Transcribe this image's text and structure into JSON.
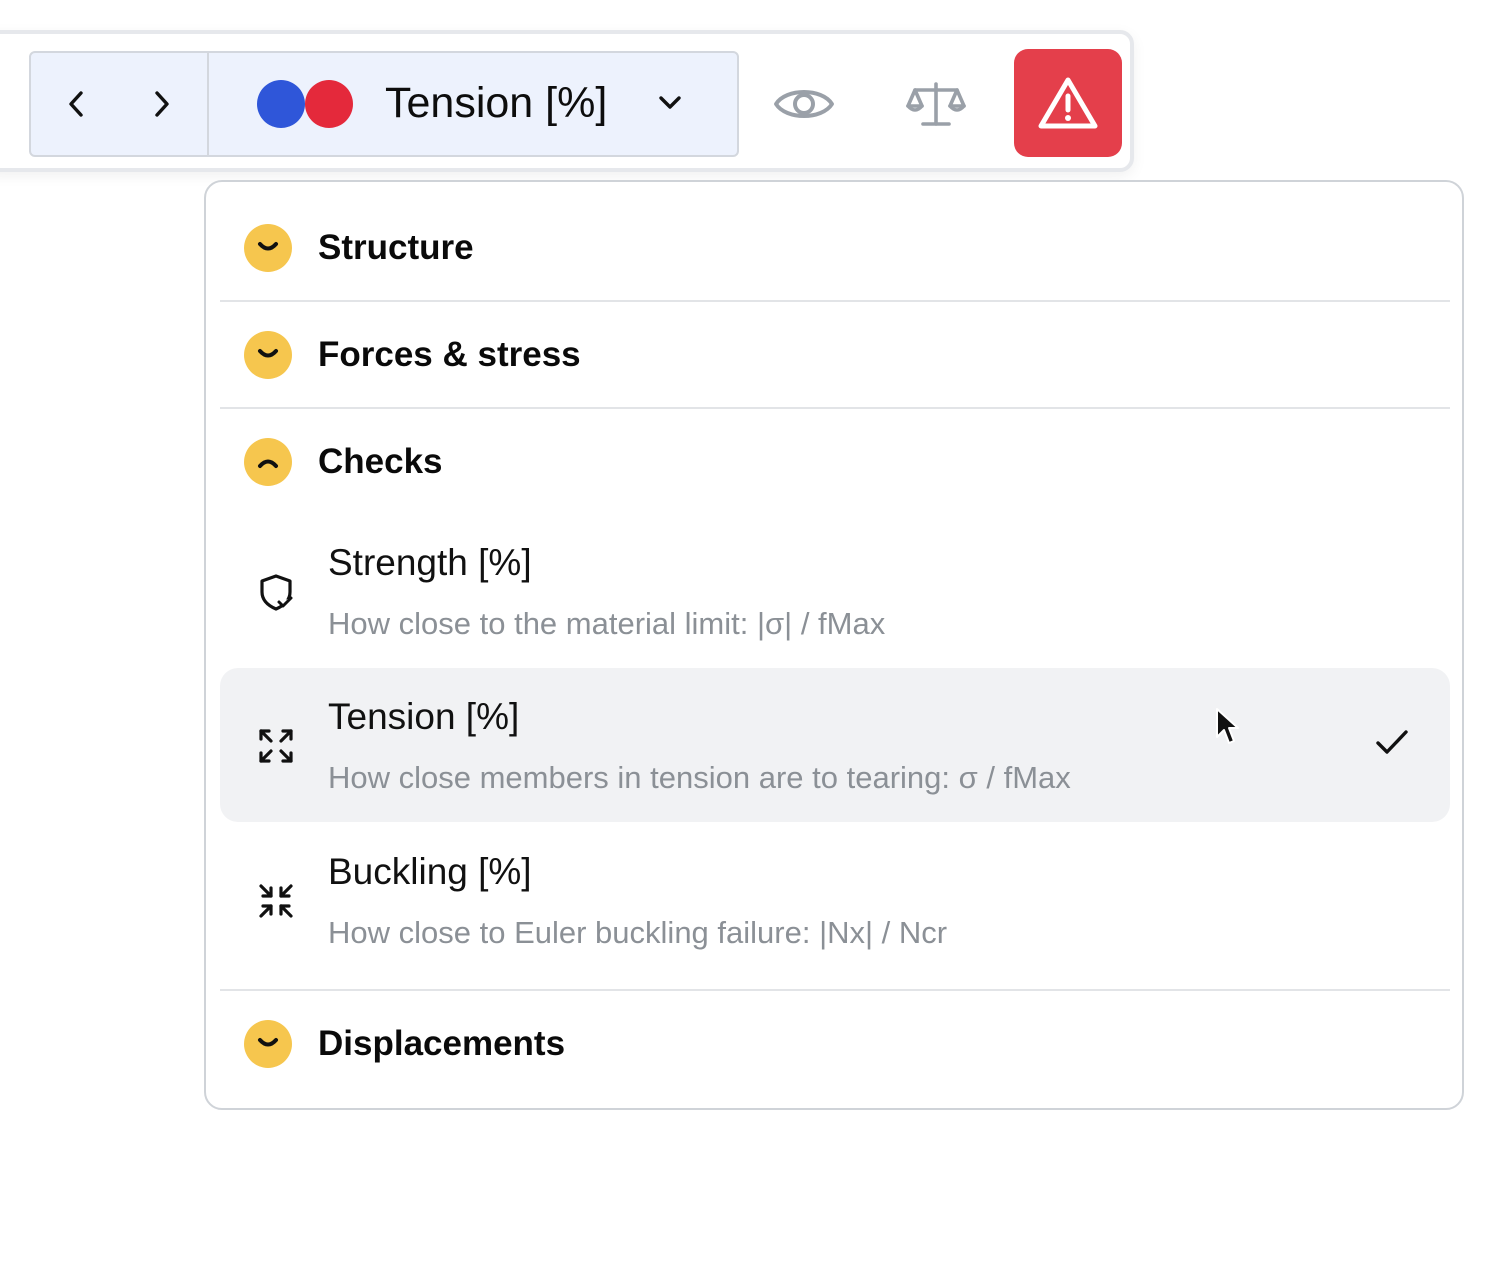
{
  "toolbar": {
    "prev_icon": "chevron-left-icon",
    "next_icon": "chevron-right-icon",
    "selected_metric": "Tension [%]",
    "legend_colors": [
      "#2f56d9",
      "#e4293b"
    ],
    "visibility_icon": "eye-icon",
    "balance_icon": "scale-icon",
    "warning_icon": "warning-triangle-icon",
    "warning_color": "#e43f4b"
  },
  "menu": {
    "sections": [
      {
        "label": "Structure",
        "expanded": false
      },
      {
        "label": "Forces & stress",
        "expanded": false
      },
      {
        "label": "Checks",
        "expanded": true
      },
      {
        "label": "Displacements",
        "expanded": false
      }
    ],
    "checks_items": [
      {
        "title": "Strength [%]",
        "description": "How close to the material limit: |σ| / fMax",
        "icon": "shield-check-icon",
        "selected": false
      },
      {
        "title": "Tension [%]",
        "description": "How close members in tension are to tearing: σ / fMax",
        "icon": "expand-arrows-icon",
        "selected": true
      },
      {
        "title": "Buckling [%]",
        "description": "How close to Euler buckling failure: |Nx| / Ncr",
        "icon": "compress-arrows-icon",
        "selected": false
      }
    ],
    "section_badge_color": "#f6c64e"
  }
}
